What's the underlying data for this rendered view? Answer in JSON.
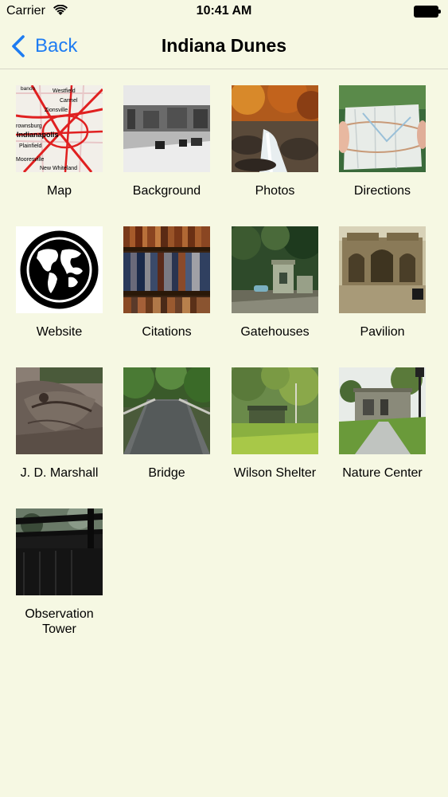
{
  "status_bar": {
    "carrier": "Carrier",
    "time": "10:41 AM"
  },
  "nav": {
    "back_label": "Back",
    "title": "Indiana Dunes"
  },
  "tiles": [
    {
      "label": "Map",
      "icon": "map-thumbnail",
      "map_labels": [
        "Westfield",
        "Carmel",
        "Zionsville",
        "Indianapolis",
        "Plainfield",
        "Mooresville",
        "New Whiteland",
        "rownsburg",
        "banon"
      ]
    },
    {
      "label": "Background",
      "icon": "historic-street-photo"
    },
    {
      "label": "Photos",
      "icon": "waterfall-photo"
    },
    {
      "label": "Directions",
      "icon": "paper-map-photo"
    },
    {
      "label": "Website",
      "icon": "globe-icon"
    },
    {
      "label": "Citations",
      "icon": "bookshelf-photo"
    },
    {
      "label": "Gatehouses",
      "icon": "gatehouse-photo"
    },
    {
      "label": "Pavilion",
      "icon": "pavilion-photo"
    },
    {
      "label": "J. D. Marshall",
      "icon": "boat-wreck-photo"
    },
    {
      "label": "Bridge",
      "icon": "bridge-photo"
    },
    {
      "label": "Wilson Shelter",
      "icon": "shelter-photo"
    },
    {
      "label": "Nature Center",
      "icon": "nature-center-photo"
    },
    {
      "label": "Observation\nTower",
      "icon": "tower-photo"
    }
  ]
}
